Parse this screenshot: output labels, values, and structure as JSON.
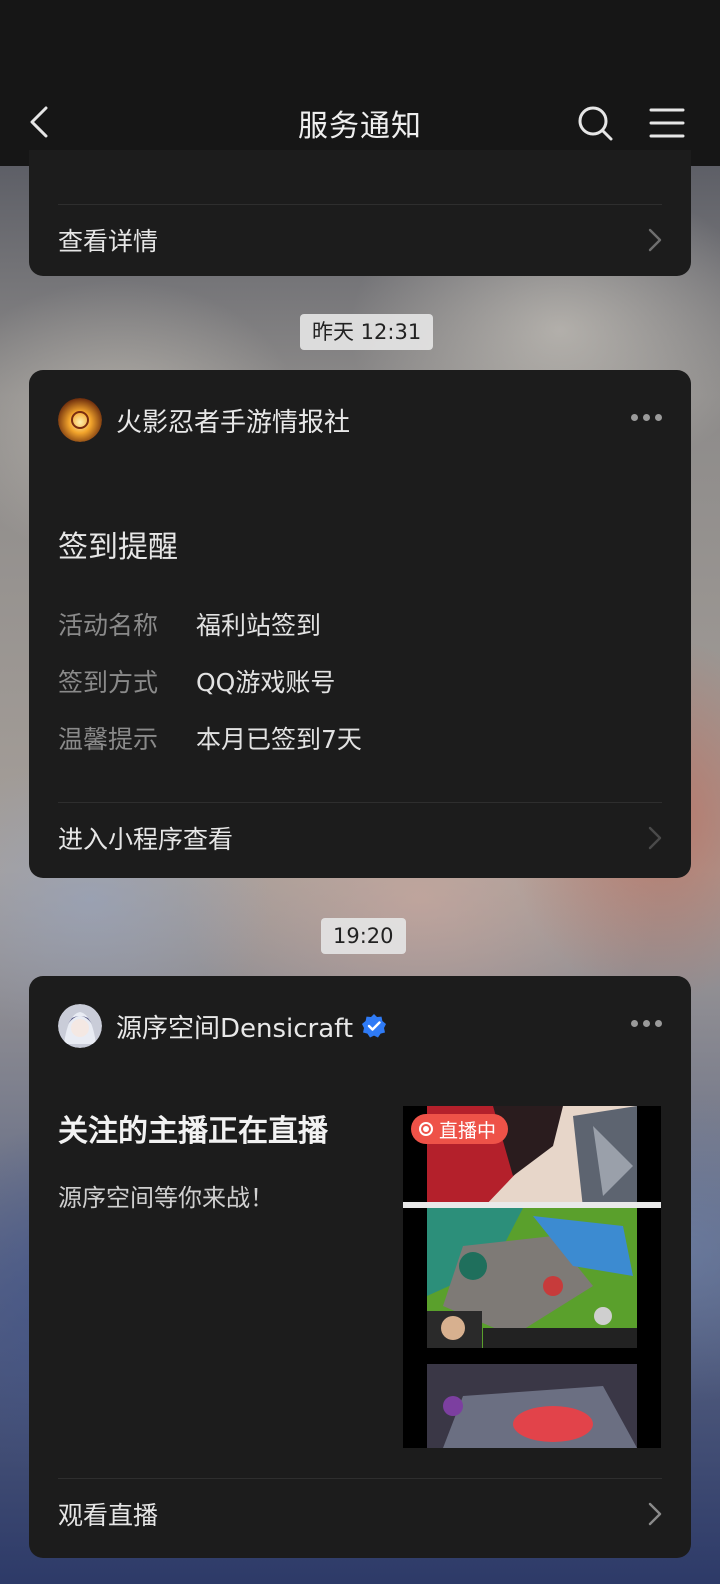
{
  "nav": {
    "title": "服务通知"
  },
  "card_prev": {
    "action_label": "查看详情"
  },
  "timestamps": {
    "first": "昨天 12:31",
    "second": "19:20"
  },
  "card_checkin": {
    "sender": "火影忍者手游情报社",
    "title": "签到提醒",
    "fields": [
      {
        "key": "活动名称",
        "value": "福利站签到"
      },
      {
        "key": "签到方式",
        "value": "QQ游戏账号"
      },
      {
        "key": "温馨提示",
        "value": "本月已签到7天"
      }
    ],
    "action_label": "进入小程序查看"
  },
  "card_live": {
    "sender": "源序空间Densicraft",
    "verified": true,
    "title": "关注的主播正在直播",
    "subtitle": "源序空间等你来战！",
    "badge": "直播中",
    "action_label": "观看直播"
  },
  "colors": {
    "live_badge": "#ee5248",
    "verified_badge": "#2f7bf6",
    "card_bg": "#1c1c1c"
  }
}
